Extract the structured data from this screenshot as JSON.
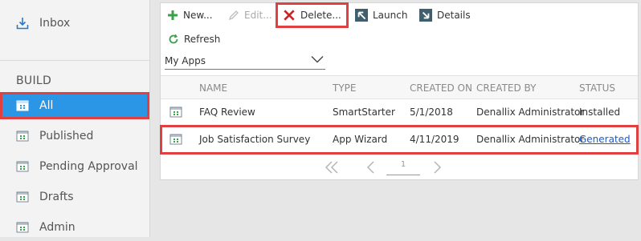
{
  "sidebar": {
    "inbox_label": "Inbox",
    "section_title": "BUILD",
    "items": [
      {
        "label": "All",
        "active": true
      },
      {
        "label": "Published"
      },
      {
        "label": "Pending Approval"
      },
      {
        "label": "Drafts"
      },
      {
        "label": "Admin"
      }
    ]
  },
  "toolbar": {
    "new_label": "New...",
    "edit_label": "Edit...",
    "delete_label": "Delete...",
    "launch_label": "Launch",
    "details_label": "Details",
    "refresh_label": "Refresh"
  },
  "filter": {
    "selected": "My Apps"
  },
  "table": {
    "columns": [
      "NAME",
      "TYPE",
      "CREATED ON",
      "CREATED BY",
      "STATUS"
    ],
    "rows": [
      {
        "name": "FAQ Review",
        "type": "SmartStarter",
        "created_on": "5/1/2018",
        "created_by": "Denallix Administrator",
        "status": "Installed"
      },
      {
        "name": "Job Satisfaction Survey",
        "type": "App Wizard",
        "created_on": "4/11/2019",
        "created_by": "Denallix Administrator",
        "status": "Generated"
      }
    ]
  },
  "pager": {
    "page": "1"
  },
  "colors": {
    "accent": "#2b95e6",
    "highlight": "#e04040",
    "new_icon": "#3aa14a",
    "delete_icon": "#c62828",
    "nav_icon": "#3f5f6f",
    "link": "#1a5ac8"
  },
  "icons": {
    "inbox": "download-tray-icon",
    "app": "app-window-icon",
    "new": "plus-icon",
    "edit": "pencil-icon",
    "delete": "x-icon",
    "launch": "arrow-up-left-icon",
    "details": "arrow-down-right-icon",
    "refresh": "refresh-icon",
    "select": "chevron-down-icon",
    "pager": [
      "double-chevron-left-icon",
      "chevron-left-icon",
      "chevron-right-icon"
    ]
  }
}
